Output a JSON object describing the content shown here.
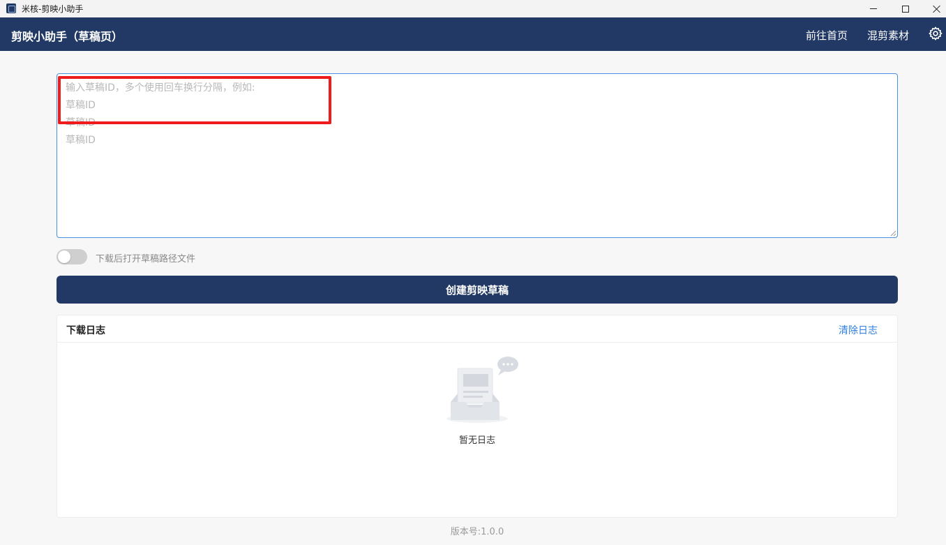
{
  "window": {
    "title": "米核-剪映小助手",
    "controls": [
      "minimize",
      "maximize",
      "close"
    ]
  },
  "header": {
    "title": "剪映小助手（草稿页）",
    "nav": {
      "home": "前往首页",
      "mix_material": "混剪素材"
    },
    "settings_icon": "gear-icon"
  },
  "draft_input": {
    "placeholder": "输入草稿ID，多个使用回车换行分隔，例如:\n草稿ID\n草稿ID\n草稿ID",
    "value": ""
  },
  "options": {
    "open_path_toggle_label": "下载后打开草稿路径文件",
    "open_path_toggle_on": false
  },
  "actions": {
    "create_label": "创建剪映草稿"
  },
  "log": {
    "title": "下载日志",
    "clear_label": "清除日志",
    "empty_text": "暂无日志"
  },
  "footer": {
    "version": "版本号:1.0.0"
  },
  "colors": {
    "primary": "#213964",
    "link": "#2f7ee0",
    "highlight": "#ee1c1c",
    "input_border": "#4a90e2"
  }
}
